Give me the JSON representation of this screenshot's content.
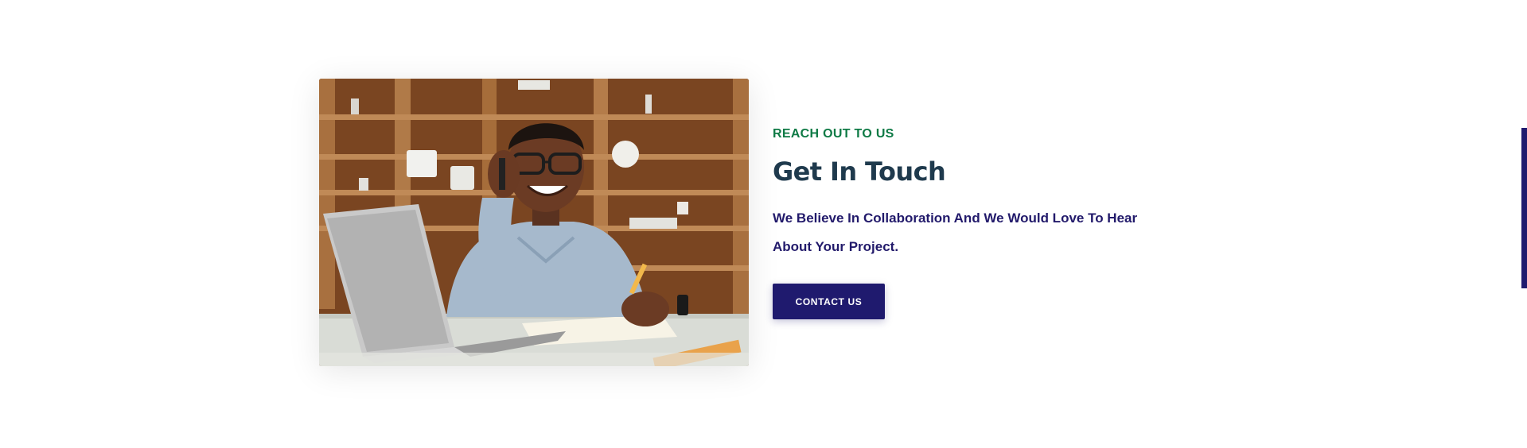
{
  "section": {
    "eyebrow": "REACH OUT TO US",
    "title": "Get In Touch",
    "description": "We Believe In Collaboration And We Would Love To Hear About Your Project.",
    "button_label": "CONTACT US"
  },
  "colors": {
    "eyebrow": "#0e7a45",
    "title": "#1f3a4d",
    "description": "#221a6b",
    "button_bg": "#1f1a6e",
    "side_tab": "#1f1a6e"
  }
}
